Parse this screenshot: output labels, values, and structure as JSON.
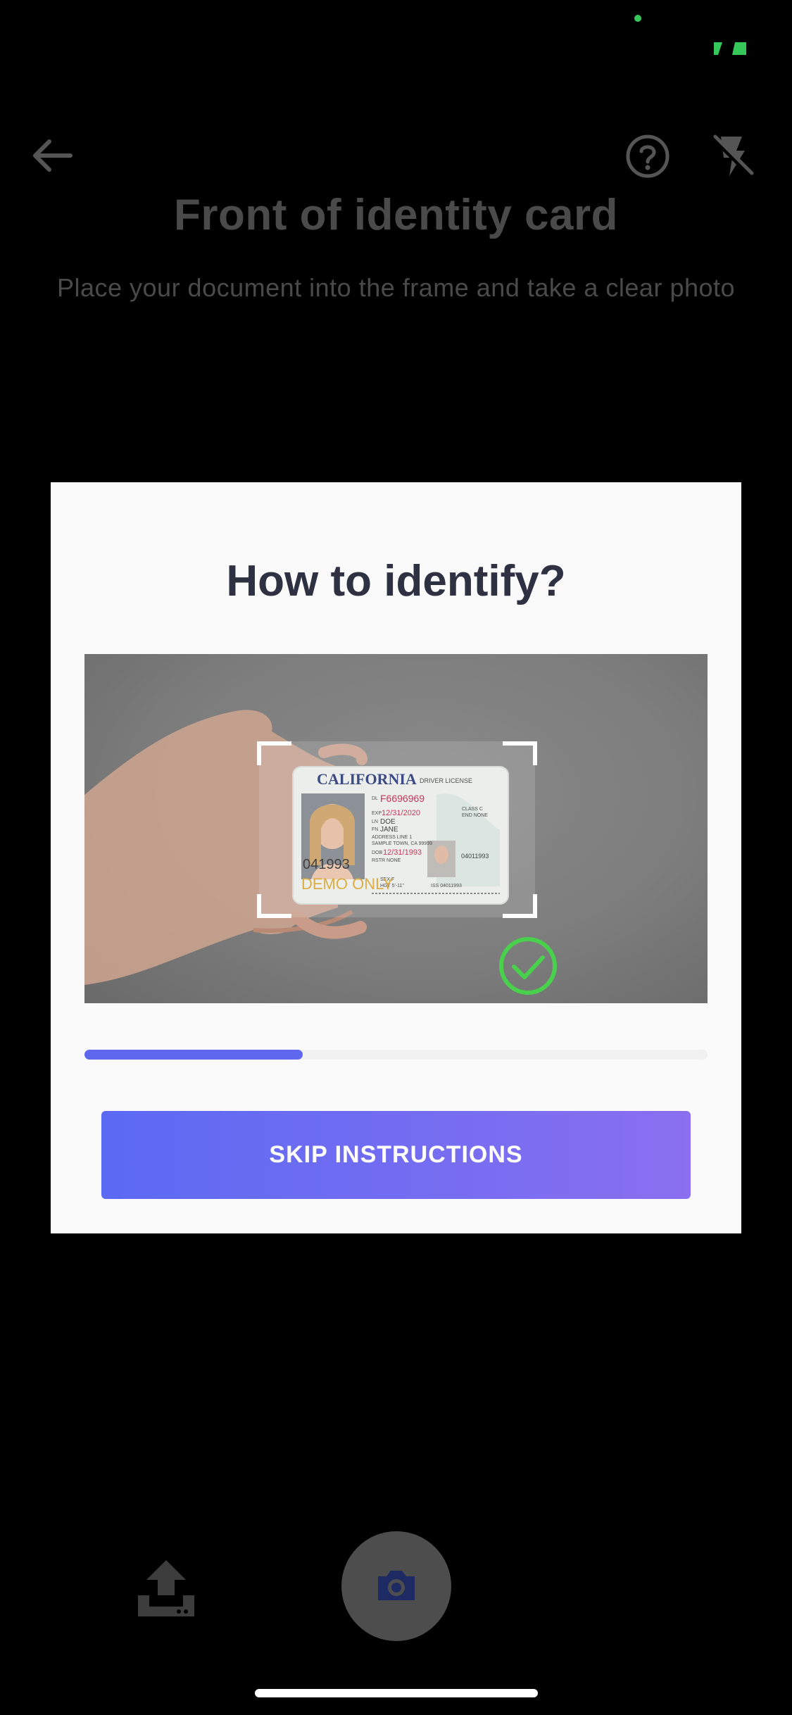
{
  "header": {
    "title": "Front of identity card",
    "subtitle": "Place your document into the frame and take a clear photo",
    "icons": {
      "back": "arrow-left-icon",
      "help": "help-circle-icon",
      "flash": "flash-off-icon"
    }
  },
  "modal": {
    "title": "How to identify?",
    "progress_fraction": 0.35,
    "skip_label": "SKIP INSTRUCTIONS",
    "card": {
      "state": "CALIFORNIA",
      "type": "DRIVER LICENSE",
      "dl_label": "DL",
      "dl_number": "F6696969",
      "exp_label": "EXP",
      "exp_date": "12/31/2020",
      "ln_label": "LN",
      "last_name": "DOE",
      "fn_label": "FN",
      "first_name": "JANE",
      "address_line": "ADDRESS LINE 1",
      "city_line": "SAMPLE TOWN, CA 99999",
      "dob_label": "DOB",
      "dob": "12/31/1993",
      "rstr": "RSTR NONE",
      "class": "CLASS C",
      "end": "END NONE",
      "sex": "SEX F",
      "hgt": "HGT 5'-11\"",
      "iss": "ISS 04011993",
      "ref": "04011993",
      "demo": "DEMO ONLY",
      "side_number": "041993"
    }
  },
  "colors": {
    "accent": "#5e67ee",
    "button_gradient_start": "#5b6af3",
    "button_gradient_end": "#8a6ff0",
    "check_green": "#35c759"
  },
  "controls": {
    "upload_icon": "upload-icon",
    "camera_icon": "camera-icon"
  }
}
